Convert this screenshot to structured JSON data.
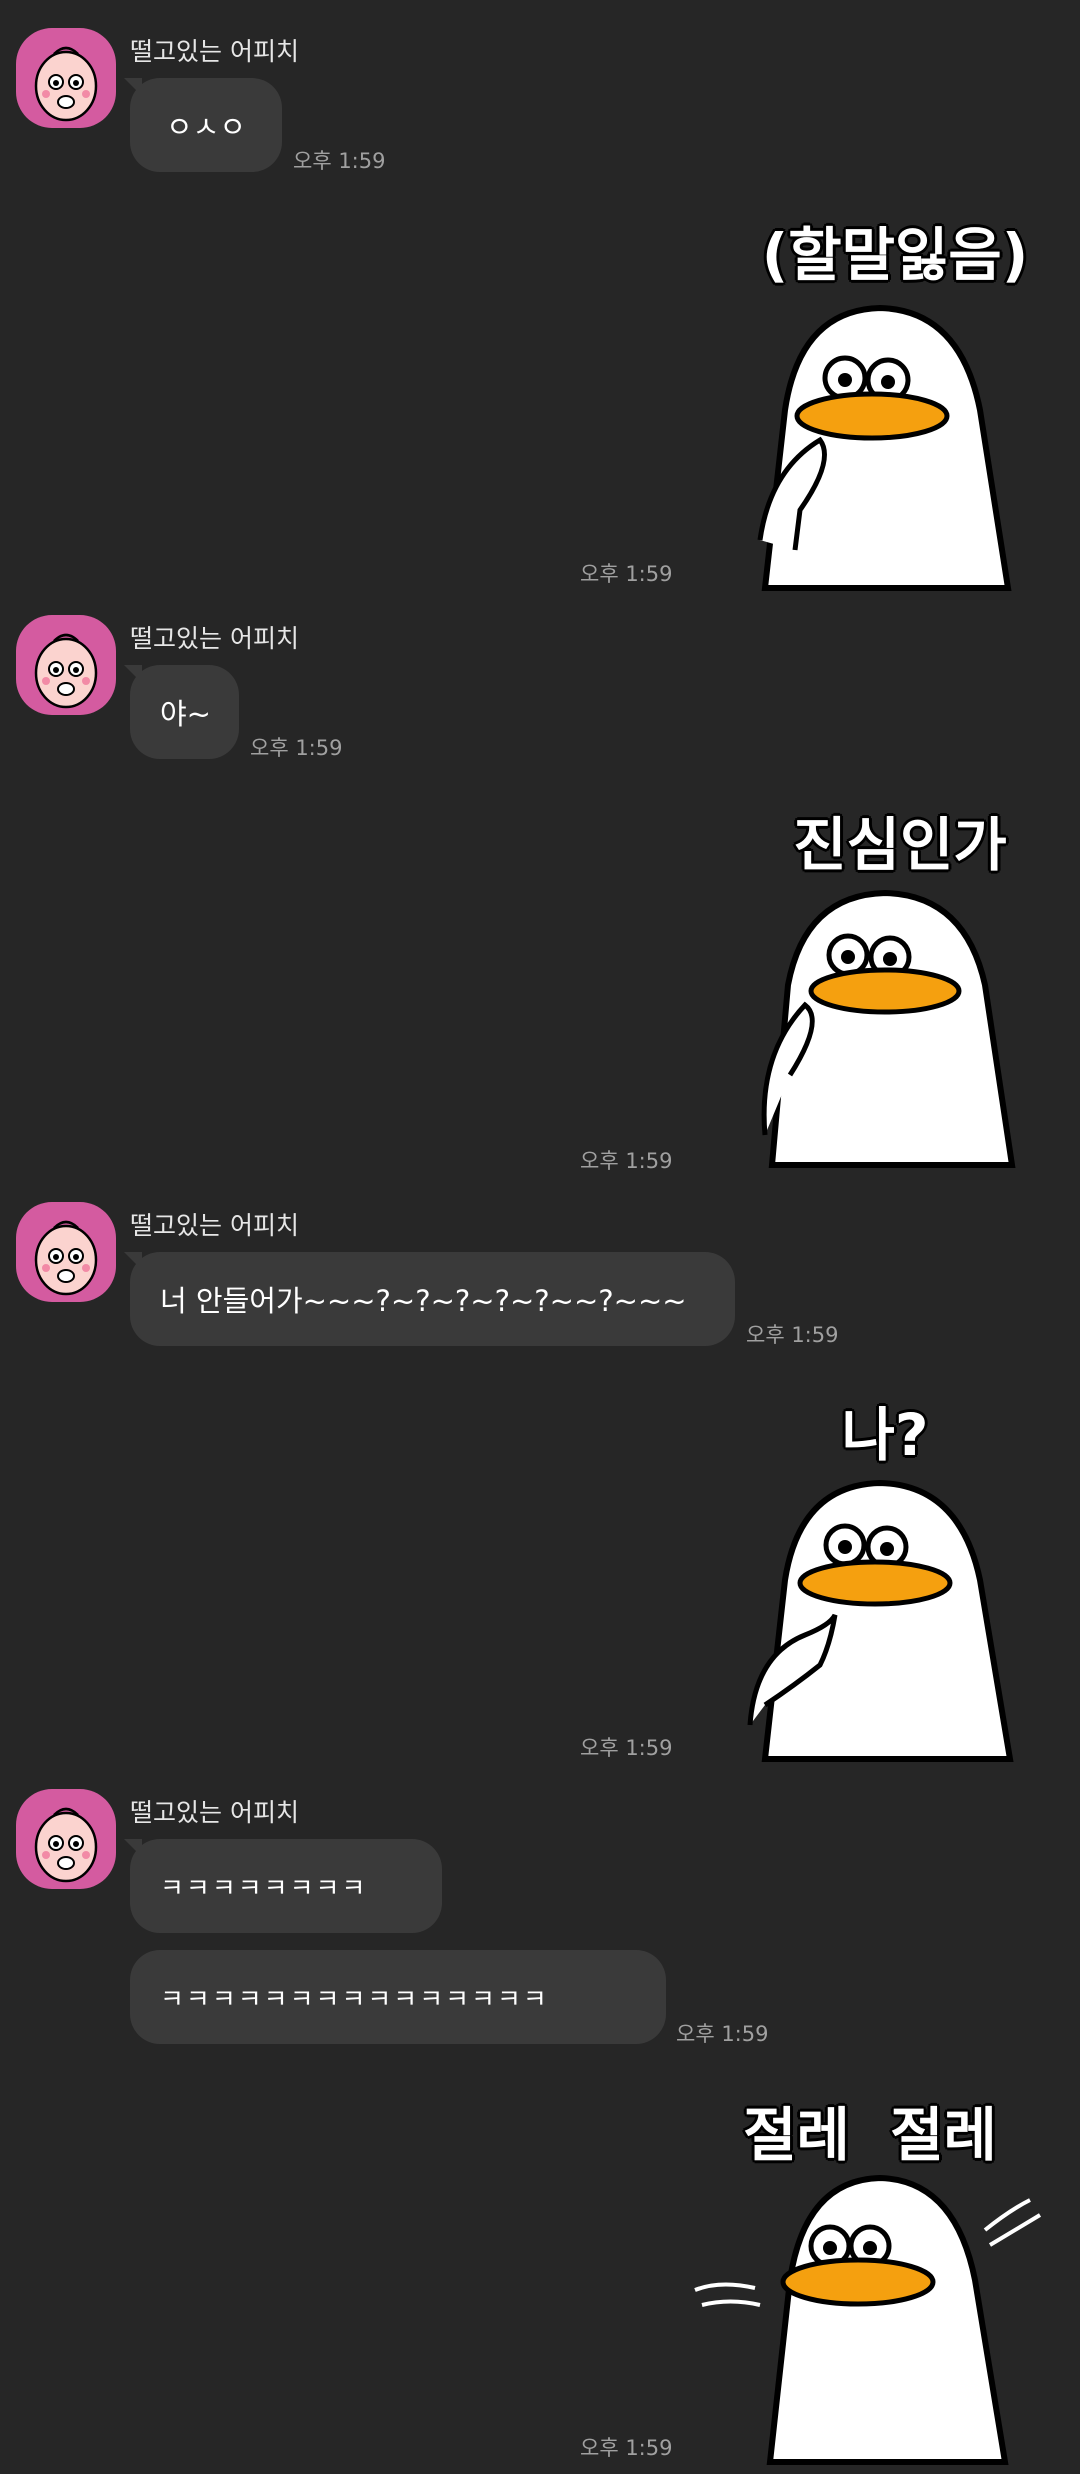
{
  "messages": [
    {
      "sender": "떨고있는 어피치",
      "bubbles": [
        "ㅇㅅㅇ"
      ],
      "time": "오후 1:59"
    },
    {
      "sticker_text": "(할말잃음)",
      "time": "오후 1:59"
    },
    {
      "sender": "떨고있는 어피치",
      "bubbles": [
        "야~"
      ],
      "time": "오후 1:59"
    },
    {
      "sticker_text": "진심인가",
      "time": "오후 1:59"
    },
    {
      "sender": "떨고있는 어피치",
      "bubbles": [
        "너 안들어가~~~?~?~?~?~?~~?~~~"
      ],
      "time": "오후 1:59"
    },
    {
      "sticker_text": "나?",
      "time": "오후 1:59"
    },
    {
      "sender": "떨고있는 어피치",
      "bubbles": [
        "ㅋㅋㅋㅋㅋㅋㅋㅋ",
        "ㅋㅋㅋㅋㅋㅋㅋㅋㅋㅋㅋㅋㅋㅋㅋ"
      ],
      "time": "오후 1:59"
    },
    {
      "sticker_text": "절레  절레",
      "time": "오후 1:59"
    }
  ],
  "colors": {
    "background": "#262626",
    "bubble": "#3a3a3a",
    "avatar": "#d45ba0",
    "duck_beak": "#f5a00f"
  },
  "icons": {
    "avatar": "peach-character-avatar",
    "sticker": "white-duck-sticker"
  }
}
